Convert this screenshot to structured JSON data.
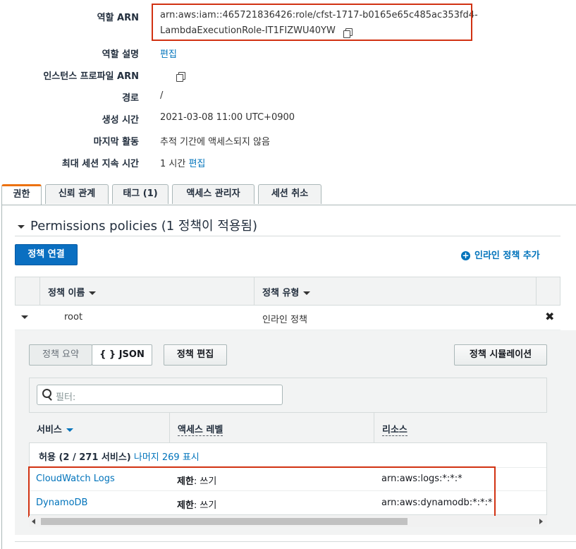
{
  "summary": {
    "role_arn_label": "역할 ARN",
    "role_arn_line1": "arn:aws:iam::465721836426:role/cfst-1717-b0165e65c485ac353fd4-",
    "role_arn_line2": "LambdaExecutionRole-IT1FIZWU40YW",
    "description_label": "역할 설명",
    "description_value": "편집",
    "instance_profile_label": "인스턴스 프로파일 ARN",
    "path_label": "경로",
    "path_value": "/",
    "created_label": "생성 시간",
    "created_value": "2021-03-08 11:00 UTC+0900",
    "last_activity_label": "마지막 활동",
    "last_activity_value": "추적 기간에 액세스되지 않음",
    "max_session_label": "최대 세션 지속 시간",
    "max_session_value": "1 시간",
    "max_session_edit": "편집"
  },
  "tabs": [
    {
      "label": "권한"
    },
    {
      "label": "신뢰 관계"
    },
    {
      "label": "태그 (1)"
    },
    {
      "label": "액세스 관리자"
    },
    {
      "label": "세션 취소"
    }
  ],
  "permissions": {
    "title": "Permissions policies",
    "subtitle": "(1 정책이 적용됨)",
    "attach_button": "정책 연결",
    "add_inline": "인라인 정책 추가",
    "col_name": "정책 이름",
    "col_type": "정책 유형",
    "row": {
      "name": "root",
      "type": "인라인 정책"
    }
  },
  "policy_detail": {
    "summary_btn": "정책 요약",
    "json_btn": "{ } JSON",
    "edit_btn": "정책 편집",
    "simulate_btn": "정책 시뮬레이션",
    "filter_placeholder": "필터:",
    "col_service": "서비스",
    "col_access": "액세스 레벨",
    "col_resource": "리소스",
    "allow_text": "허용 (2 / 271 서비스)",
    "show_rest": "나머지 269 표시",
    "rows": [
      {
        "service": "CloudWatch Logs",
        "access_bold": "제한",
        "access_rest": ": 쓰기",
        "resource": "arn:aws:logs:*:*:*"
      },
      {
        "service": "DynamoDB",
        "access_bold": "제한",
        "access_rest": ": 쓰기",
        "resource": "arn:aws:dynamodb:*:*:*"
      }
    ]
  },
  "colors": {
    "link": "#0073bb",
    "primary": "#0a6fc1",
    "active_tab": "#ec7211",
    "highlight": "#d13212"
  }
}
